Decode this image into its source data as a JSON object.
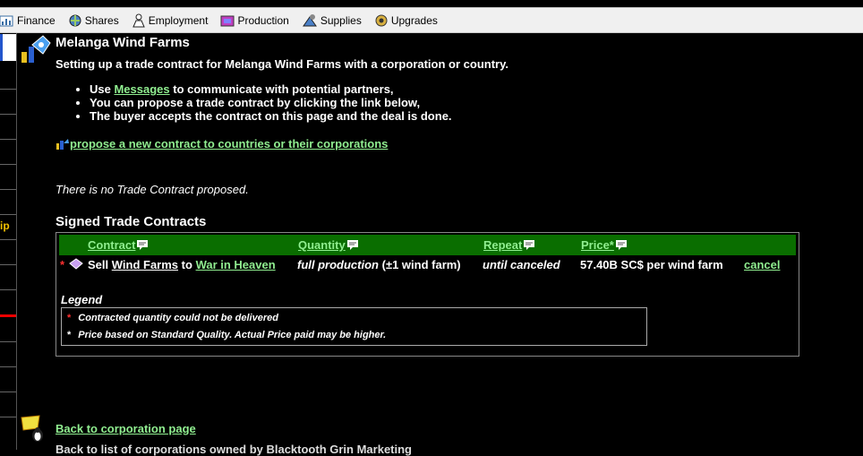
{
  "menu": [
    {
      "label": "Finance",
      "icon": "finance-icon"
    },
    {
      "label": "Shares",
      "icon": "shares-icon"
    },
    {
      "label": "Employment",
      "icon": "employment-icon"
    },
    {
      "label": "Production",
      "icon": "production-icon"
    },
    {
      "label": "Supplies",
      "icon": "supplies-icon"
    },
    {
      "label": "Upgrades",
      "icon": "upgrades-icon"
    }
  ],
  "sidebar": {
    "partial_label": "ip"
  },
  "page": {
    "title": "Melanga Wind Farms",
    "intro": "Setting up a trade contract for Melanga Wind Farms with a corporation or country."
  },
  "bullets": {
    "b1_pre": "Use ",
    "b1_link": "Messages",
    "b1_post": " to communicate with potential partners,",
    "b2": "You can propose a trade contract by clicking the link below,",
    "b3": "The buyer accepts the contract on this page and the deal is done."
  },
  "propose_link": "propose a new contract to countries or their corporations",
  "no_contract": "There is no Trade Contract proposed.",
  "signed": {
    "title": "Signed Trade Contracts",
    "headers": {
      "contract": "Contract",
      "quantity": "Quantity",
      "repeat": "Repeat",
      "price": "Price*"
    },
    "row": {
      "marker": "*",
      "verb": "Sell",
      "product": "Wind Farms",
      "to": "to",
      "partner": "War in Heaven",
      "quantity": "full production",
      "quantity_note": "(±1 wind farm)",
      "repeat": "until canceled",
      "price": "57.40B SC$ per wind farm",
      "action": "cancel"
    }
  },
  "legend": {
    "title": "Legend",
    "items": [
      {
        "marker": "*",
        "text": "Contracted quantity could not be delivered"
      },
      {
        "marker": "*",
        "text": "Price based on Standard Quality. Actual Price paid may be higher."
      }
    ]
  },
  "back_link": "Back to corporation page",
  "cut_text": "Back to list of corporations owned by Blacktooth Grin Marketing"
}
